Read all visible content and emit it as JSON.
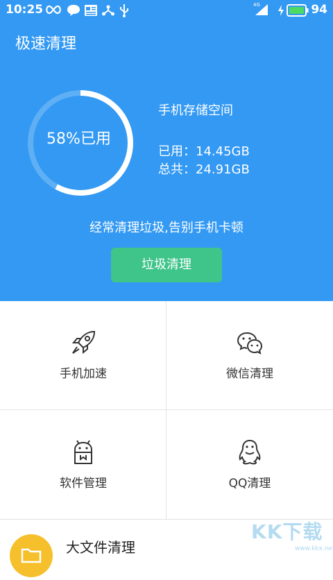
{
  "status_bar": {
    "time": "10:25",
    "battery_percent": "94",
    "network_label": "4G",
    "icons": [
      "infinity-icon",
      "chat-icon",
      "news-icon",
      "share-icon",
      "usb-icon",
      "signal-icon",
      "charging-icon",
      "battery-icon"
    ]
  },
  "header": {
    "title": "极速清理",
    "ring_text": "58%已用",
    "used_fraction": 0.58,
    "storage_title": "手机存储空间",
    "used_label": "已用：",
    "used_value": "14.45GB",
    "total_label": "总共：",
    "total_value": "24.91GB",
    "tagline": "经常清理垃圾,告别手机卡顿",
    "clean_button": "垃圾清理"
  },
  "tiles": [
    {
      "label": "手机加速",
      "icon": "rocket-icon"
    },
    {
      "label": "微信清理",
      "icon": "wechat-icon"
    },
    {
      "label": "软件管理",
      "icon": "android-icon"
    },
    {
      "label": "QQ清理",
      "icon": "penguin-icon"
    }
  ],
  "bottom": {
    "label": "大文件清理",
    "icon": "folder-icon"
  },
  "watermark": {
    "text": "KK下载",
    "sub": "www.kkx.net"
  },
  "colors": {
    "primary": "#3399f3",
    "button": "#3fc48a",
    "folder": "#f5c02c"
  }
}
